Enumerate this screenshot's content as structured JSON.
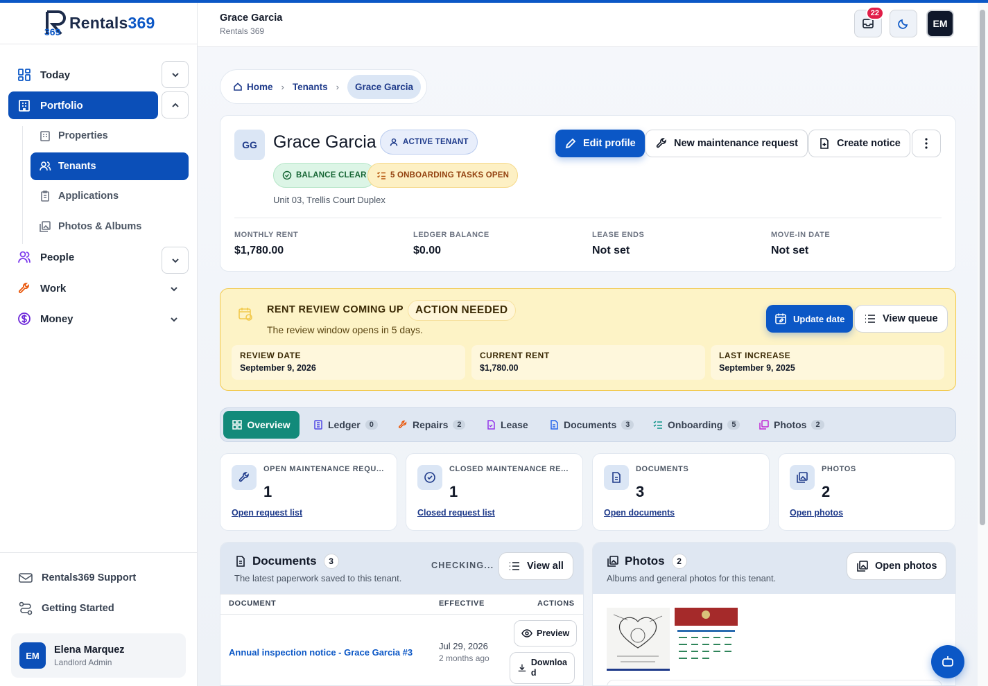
{
  "brand": {
    "name_prefix": "Rentals",
    "name_suffix": "369",
    "logo_mark": "369"
  },
  "header": {
    "title": "Grace Garcia",
    "subtitle": "Rentals 369",
    "notifications": "22",
    "user_initials": "EM"
  },
  "sidebar": {
    "items": [
      {
        "label": "Today",
        "icon": "dashboard-icon"
      },
      {
        "label": "Portfolio",
        "icon": "building-icon"
      },
      {
        "label": "People",
        "icon": "people-icon"
      },
      {
        "label": "Work",
        "icon": "wrench-icon"
      },
      {
        "label": "Money",
        "icon": "dollar-icon"
      }
    ],
    "portfolio_sub": [
      {
        "label": "Properties",
        "icon": "building-small-icon"
      },
      {
        "label": "Tenants",
        "icon": "users-icon"
      },
      {
        "label": "Applications",
        "icon": "clipboard-icon"
      },
      {
        "label": "Photos & Albums",
        "icon": "images-icon"
      }
    ],
    "footer": [
      {
        "label": "Rentals369 Support",
        "icon": "support-icon"
      },
      {
        "label": "Getting Started",
        "icon": "route-icon"
      }
    ],
    "user": {
      "initials": "EM",
      "name": "Elena Marquez",
      "role": "Landlord Admin"
    }
  },
  "breadcrumb": {
    "home": "Home",
    "tenants": "Tenants",
    "current": "Grace Garcia"
  },
  "profile": {
    "initials": "GG",
    "name": "Grace Garcia",
    "status": "ACTIVE TENANT",
    "balance_badge": "BALANCE CLEAR",
    "onboarding_badge": "5 ONBOARDING TASKS OPEN",
    "address": "Unit 03, Trellis Court Duplex",
    "edit": "Edit profile",
    "maintenance": "New maintenance request",
    "notice": "Create notice",
    "stats": [
      {
        "label": "MONTHLY RENT",
        "value": "$1,780.00"
      },
      {
        "label": "LEDGER BALANCE",
        "value": "$0.00"
      },
      {
        "label": "LEASE ENDS",
        "value": "Not set"
      },
      {
        "label": "MOVE-IN DATE",
        "value": "Not set"
      }
    ]
  },
  "banner": {
    "title": "RENT REVIEW COMING UP",
    "pill": "ACTION NEEDED",
    "subtitle": "The review window opens in 5 days.",
    "update": "Update date",
    "queue": "View queue",
    "boxes": [
      {
        "label": "REVIEW DATE",
        "value": "September 9, 2026"
      },
      {
        "label": "CURRENT RENT",
        "value": "$1,780.00"
      },
      {
        "label": "LAST INCREASE",
        "value": "September 9, 2025"
      }
    ],
    "colors": {
      "bg": "#fdf3c6",
      "border": "#f2c94c"
    }
  },
  "tabs": [
    {
      "label": "Overview",
      "count": ""
    },
    {
      "label": "Ledger",
      "count": "0"
    },
    {
      "label": "Repairs",
      "count": "2"
    },
    {
      "label": "Lease",
      "count": ""
    },
    {
      "label": "Documents",
      "count": "3"
    },
    {
      "label": "Onboarding",
      "count": "5"
    },
    {
      "label": "Photos",
      "count": "2"
    }
  ],
  "summary": [
    {
      "label": "OPEN MAINTENANCE REQU...",
      "value": "1",
      "link": "Open request list"
    },
    {
      "label": "CLOSED MAINTENANCE RE...",
      "value": "1",
      "link": "Closed request list"
    },
    {
      "label": "DOCUMENTS",
      "value": "3",
      "link": "Open documents"
    },
    {
      "label": "PHOTOS",
      "value": "2",
      "link": "Open photos"
    }
  ],
  "documents": {
    "title": "Documents",
    "count": "3",
    "subtitle": "The latest paperwork saved to this tenant.",
    "status": "CHECKING...",
    "view_all": "View all",
    "columns": [
      "DOCUMENT",
      "EFFECTIVE",
      "ACTIONS"
    ],
    "rows": [
      {
        "name": "Annual inspection notice - Grace Garcia #3",
        "date": "Jul 29, 2026",
        "ago": "2 months ago",
        "preview": "Preview",
        "download_line1": "Downloa",
        "download_line2": "d"
      }
    ]
  },
  "photos": {
    "title": "Photos",
    "count": "2",
    "subtitle": "Albums and general photos for this tenant.",
    "open": "Open photos"
  },
  "colors": {
    "primary": "#0b57c6",
    "primary_dark": "#0b4fb8",
    "tab_active": "#128a7a"
  }
}
